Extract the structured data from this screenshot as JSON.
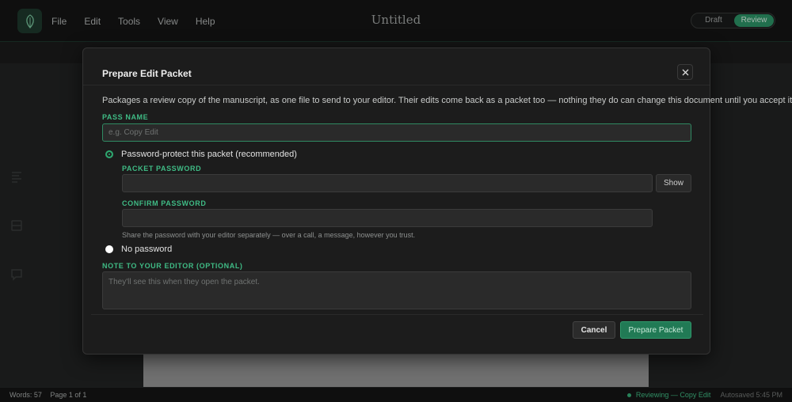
{
  "app": {
    "document_title": "Untitled",
    "menu": [
      "File",
      "Edit",
      "Tools",
      "View",
      "Help"
    ],
    "mode": {
      "draft": "Draft",
      "review": "Review",
      "active": "Review"
    }
  },
  "status": {
    "words": "Words: 57",
    "page": "Page 1 of 1",
    "reviewing": "Reviewing — Copy Edit",
    "autosave": "Autosaved 5:45 PM"
  },
  "modal": {
    "title": "Prepare Edit Packet",
    "description": "Packages a review copy of the manuscript, as one file to send to your editor. Their edits come back as a packet too — nothing they do can change this document until you accept it.",
    "pass_name": {
      "label": "PASS NAME",
      "placeholder": "e.g. Copy Edit",
      "value": ""
    },
    "protect_option": {
      "label": "Password-protect this packet (recommended)",
      "selected": true
    },
    "packet_password": {
      "label": "PACKET PASSWORD",
      "value": "",
      "show_label": "Show"
    },
    "confirm_password": {
      "label": "CONFIRM PASSWORD",
      "value": ""
    },
    "password_hint": "Share the password with your editor separately — over a call, a message, however you trust.",
    "no_password_option": {
      "label": "No password",
      "selected": false
    },
    "note": {
      "label": "NOTE TO YOUR EDITOR (OPTIONAL)",
      "placeholder": "They'll see this when they open the packet.",
      "value": ""
    },
    "cancel_label": "Cancel",
    "prepare_label": "Prepare Packet"
  },
  "colors": {
    "accent": "#2e9a6b",
    "label_green": "#3fbb85",
    "modal_bg": "#1c1c1c",
    "app_bg": "#141515"
  },
  "icons": {
    "logo": "leaf-icon",
    "close": "close-icon",
    "sidebar": [
      "outline-icon",
      "book-icon",
      "comment-icon"
    ]
  }
}
